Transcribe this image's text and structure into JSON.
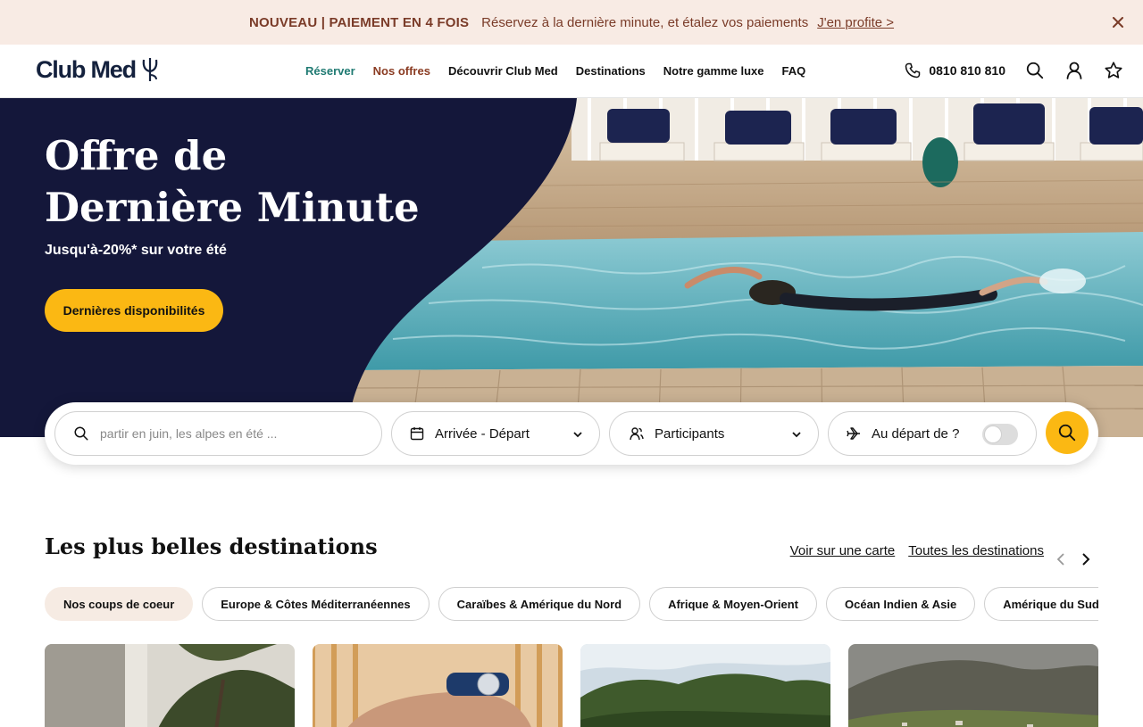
{
  "promo": {
    "tag": "NOUVEAU | PAIEMENT EN 4 FOIS",
    "message": "Réservez à la dernière minute, et étalez vos paiements",
    "link": "J'en profite >"
  },
  "header": {
    "logo": "Club Med",
    "nav": [
      "Réserver",
      "Nos offres",
      "Découvrir Club Med",
      "Destinations",
      "Notre gamme luxe",
      "FAQ"
    ],
    "phone": "0810 810 810",
    "icons": [
      "search-icon",
      "user-icon",
      "star-icon"
    ]
  },
  "hero": {
    "title_line1": "Offre de",
    "title_line2": "Dernière Minute",
    "subtitle": "Jusqu'à-20%* sur votre été",
    "cta": "Dernières disponibilités"
  },
  "search": {
    "placeholder": "partir en juin, les alpes en été ...",
    "dates": "Arrivée - Départ",
    "participants": "Participants",
    "departure": "Au départ de ?"
  },
  "destinations": {
    "title": "Les plus belles destinations",
    "map_link": "Voir sur une carte",
    "all_link": "Toutes les destinations",
    "chips": [
      "Nos coups de coeur",
      "Europe & Côtes Méditerranéennes",
      "Caraïbes & Amérique du Nord",
      "Afrique & Moyen-Orient",
      "Océan Indien & Asie",
      "Amérique du Sud et Centrale"
    ],
    "active_chip": "Nos coups de coeur"
  },
  "colors": {
    "navy": "#14173a",
    "accent_yellow": "#fbb813",
    "teal": "#1f7a72",
    "rust": "#8a3b22",
    "promo_bg": "#f8ebe4"
  }
}
